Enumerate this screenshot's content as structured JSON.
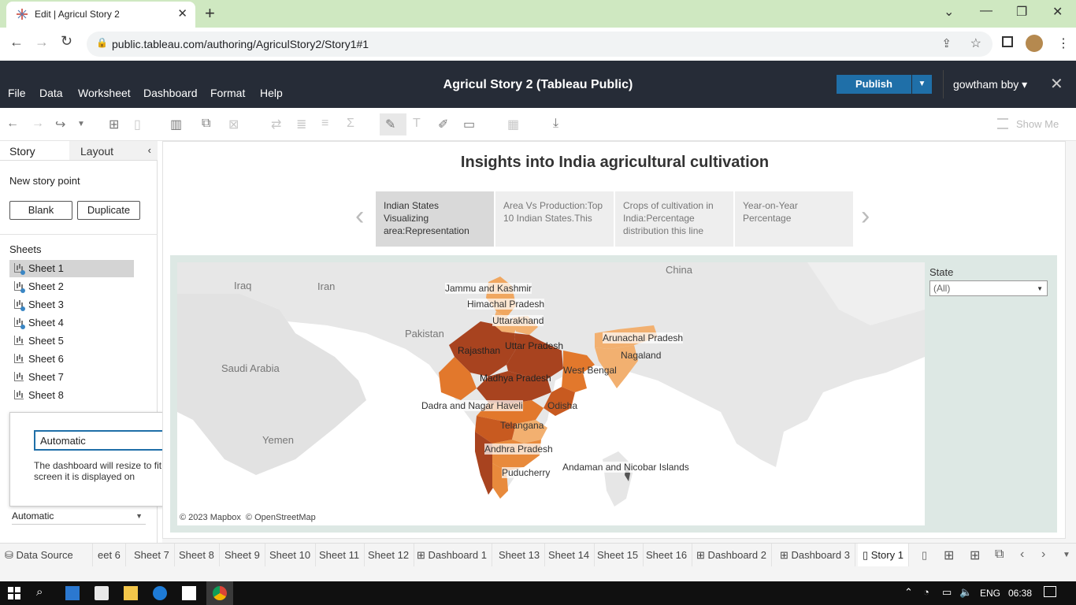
{
  "browser": {
    "tab_title": "Edit | Agricul Story 2",
    "url": "public.tableau.com/authoring/AgriculStory2/Story1#1"
  },
  "app": {
    "title": "Agricul Story 2 (Tableau Public)",
    "menu": [
      "File",
      "Data",
      "Worksheet",
      "Dashboard",
      "Format",
      "Help"
    ],
    "publish_label": "Publish",
    "user": "gowtham bby",
    "show_me": "Show Me"
  },
  "left_panel": {
    "tabs": [
      "Story",
      "Layout"
    ],
    "new_story_point": "New story point",
    "blank_label": "Blank",
    "duplicate_label": "Duplicate",
    "sheets_header": "Sheets",
    "sheets": [
      "Sheet 1",
      "Sheet 2",
      "Sheet 3",
      "Sheet 4",
      "Sheet 5",
      "Sheet 6",
      "Sheet 7",
      "Sheet 8"
    ],
    "size_option": "Automatic",
    "size_description": "The dashboard will resize to fit any screen it is displayed on",
    "size_bottom": "Automatic"
  },
  "story": {
    "title": "Insights into India agricultural cultivation",
    "points": [
      "Indian States Visualizing area:Representation",
      "Area Vs Production:Top 10 Indian States.This",
      "Crops of cultivation in India:Percentage distribution this line",
      "Year-on-Year Percentage"
    ]
  },
  "map": {
    "countries": [
      "Iraq",
      "Iran",
      "China",
      "Pakistan",
      "Saudi Arabia",
      "Yemen"
    ],
    "states": [
      "Jammu and Kashmir",
      "Himachal Pradesh",
      "Uttarakhand",
      "Rajasthan",
      "Uttar Pradesh",
      "Arunachal Pradesh",
      "Nagaland",
      "West Bengal",
      "Madhya Pradesh",
      "Odisha",
      "Dadra and Nagar Haveli",
      "Telangana",
      "Andhra Pradesh",
      "Puducherry",
      "Andaman and Nicobar Islands"
    ],
    "attribution": "© 2023 Mapbox  © OpenStreetMap",
    "filter_label": "State",
    "filter_value": "(All)"
  },
  "bottom_tabs": [
    "Data Source",
    "eet 6",
    "Sheet 7",
    "Sheet 8",
    "Sheet 9",
    "Sheet 10",
    "Sheet 11",
    "Sheet 12",
    "Dashboard 1",
    "Sheet 13",
    "Sheet 14",
    "Sheet 15",
    "Sheet 16",
    "Dashboard 2",
    "Dashboard 3",
    "Story 1"
  ],
  "taskbar": {
    "lang": "ENG",
    "time": "06:38"
  },
  "colors": {
    "header_bg": "#262c37",
    "publish": "#1f6fa8",
    "tab_strip": "#cfe8c1"
  }
}
